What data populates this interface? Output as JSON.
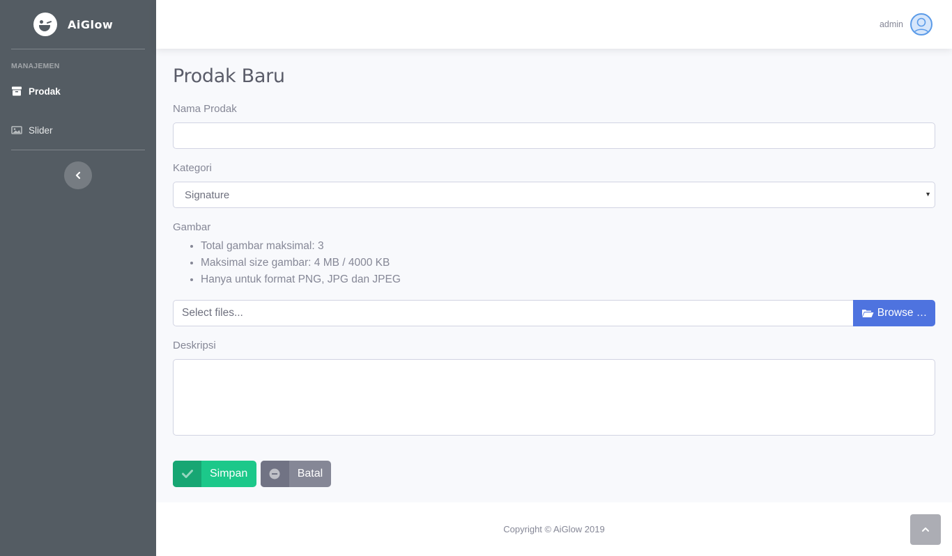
{
  "brand": {
    "name": "AiGlow"
  },
  "sidebar": {
    "heading": "MANAJEMEN",
    "items": [
      {
        "label": "Prodak",
        "icon": "box-icon",
        "active": true
      },
      {
        "label": "Slider",
        "icon": "image-icon",
        "active": false
      }
    ]
  },
  "topbar": {
    "user_name": "admin"
  },
  "page": {
    "title": "Prodak Baru"
  },
  "form": {
    "name_label": "Nama Prodak",
    "name_value": "",
    "category_label": "Kategori",
    "category_value": "Signature",
    "image_label": "Gambar",
    "image_rules": [
      "Total gambar maksimal: 3",
      "Maksimal size gambar: 4 MB / 4000 KB",
      "Hanya untuk format PNG, JPG dan JPEG"
    ],
    "file_placeholder": "Select files...",
    "browse_label": "Browse …",
    "description_label": "Deskripsi",
    "description_value": "",
    "save_label": "Simpan",
    "cancel_label": "Batal"
  },
  "footer": {
    "copyright": "Copyright © AiGlow 2019"
  },
  "colors": {
    "sidebar": "#545c63",
    "primary": "#4e73df",
    "success": "#1cc88a",
    "secondary": "#858796"
  }
}
